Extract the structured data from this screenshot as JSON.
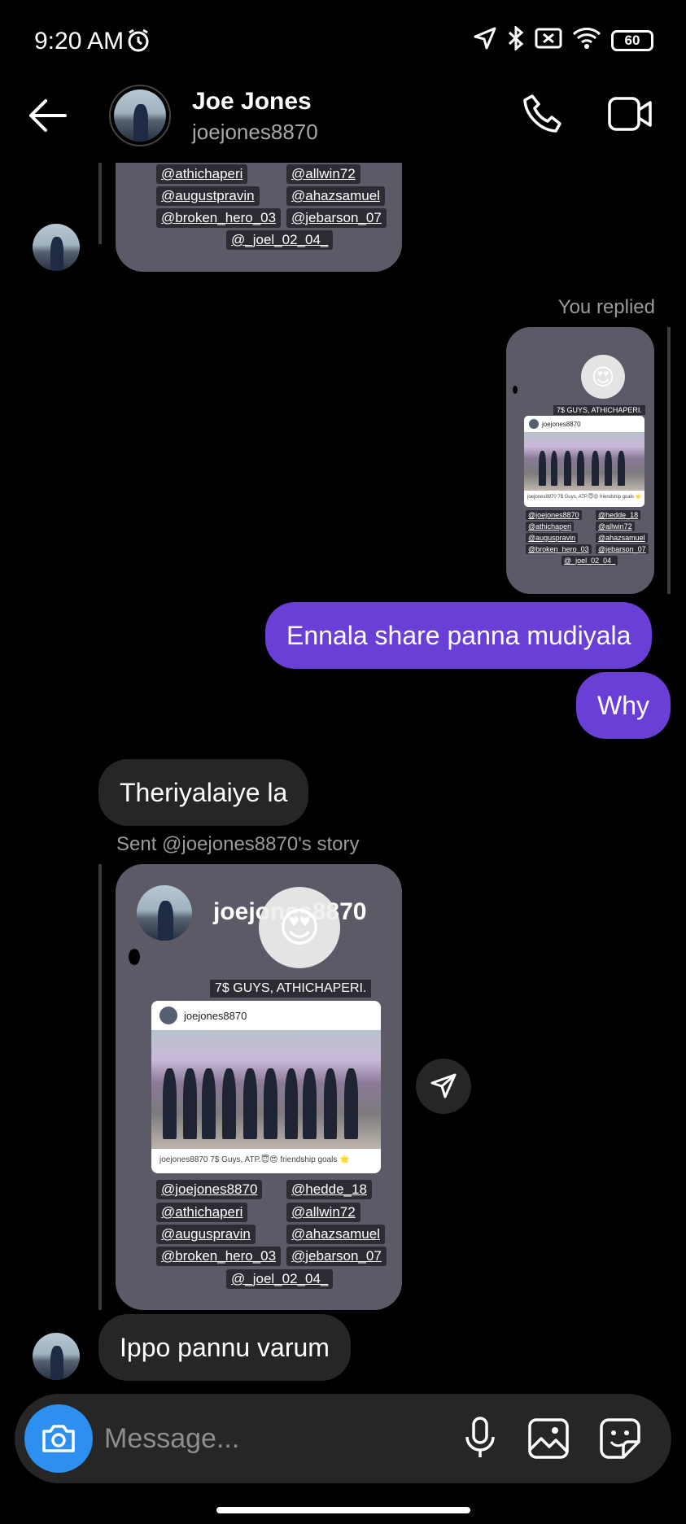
{
  "status": {
    "time": "9:20 AM",
    "battery": "60"
  },
  "header": {
    "name": "Joe Jones",
    "username": "joejones8870"
  },
  "top_story": {
    "tags_left": [
      "@athichaperi",
      "@augustpravin",
      "@broken_hero_03"
    ],
    "tags_right": [
      "@allwin72",
      "@ahazsamuel",
      "@jebarson_07"
    ],
    "tag_center": "@_joel_02_04_"
  },
  "reply_label": "You replied",
  "reply_story": {
    "emoji": "😍",
    "caption": "7$ GUYS, ATHICHAPERI.",
    "user": "joejones8870",
    "post_caption": "joejones8870 7$ Guys, ATP.😇😍 friendship goals 🌟",
    "tags_left": [
      "@joejones8870",
      "@athichaperi",
      "@auguspravin",
      "@broken_hero_03"
    ],
    "tags_right": [
      "@hedde_18",
      "@allwin72",
      "@ahazsamuel",
      "@jebarson_07"
    ],
    "tag_center": "@_joel_02_04_"
  },
  "messages": {
    "out1": "Ennala share panna mudiyala",
    "out2": "Why",
    "in1": "Theriyalaiye la",
    "in2": "Ippo pannu varum"
  },
  "story_label": "Sent @joejones8870's story",
  "shared_story": {
    "username": "joejones8870",
    "emoji": "😍",
    "caption": "7$ GUYS, ATHICHAPERI.",
    "post_user": "joejones8870",
    "post_caption": "joejones8870 7$ Guys, ATP.😇😍 friendship goals 🌟",
    "tags_left": [
      "@joejones8870",
      "@athichaperi",
      "@auguspravin",
      "@broken_hero_03"
    ],
    "tags_right": [
      "@hedde_18",
      "@allwin72",
      "@ahazsamuel",
      "@jebarson_07"
    ],
    "tag_center": "@_joel_02_04_"
  },
  "composer": {
    "placeholder": "Message..."
  }
}
